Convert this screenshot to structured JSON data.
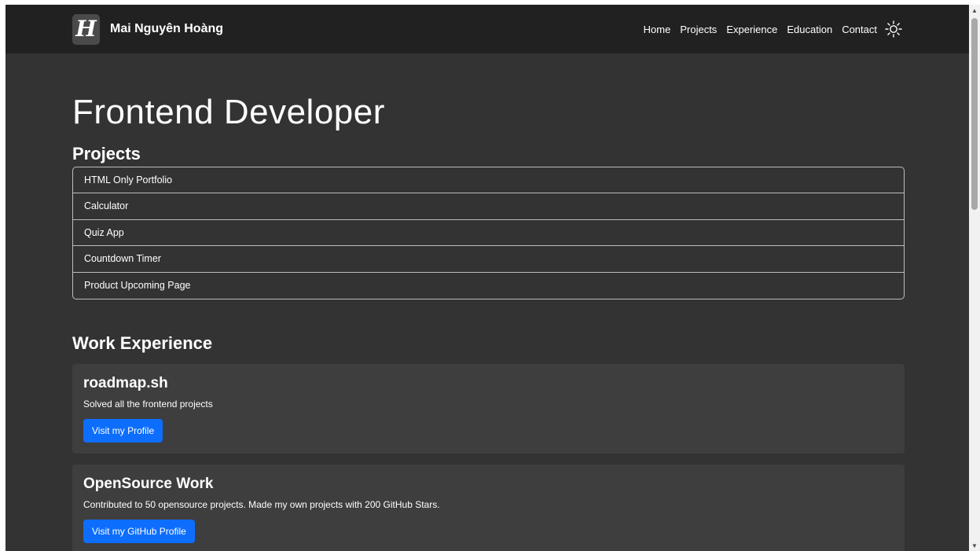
{
  "header": {
    "logo_letter": "H",
    "brand_name": "Mai Nguyên Hoàng",
    "nav": [
      "Home",
      "Projects",
      "Experience",
      "Education",
      "Contact"
    ],
    "theme_icon": "sun-icon"
  },
  "hero": {
    "title": "Frontend Developer"
  },
  "projects": {
    "title": "Projects",
    "items": [
      "HTML Only Portfolio",
      "Calculator",
      "Quiz App",
      "Countdown Timer",
      "Product Upcoming Page"
    ]
  },
  "work": {
    "title": "Work Experience",
    "cards": [
      {
        "title": "roadmap.sh",
        "desc": "Solved all the frontend projects",
        "button": "Visit my Profile"
      },
      {
        "title": "OpenSource Work",
        "desc": "Contributed to 50 opensource projects. Made my own projects with 200 GitHub Stars.",
        "button": "Visit my GitHub Profile"
      }
    ]
  },
  "colors": {
    "page_bg": "#333333",
    "navbar_bg": "#212121",
    "card_bg": "#3e3e3e",
    "accent": "#0d6efd"
  }
}
